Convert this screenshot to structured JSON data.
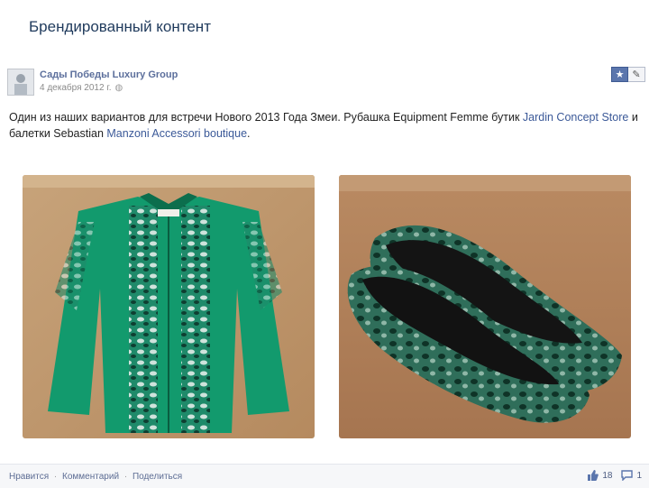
{
  "slide": {
    "title": "Брендированный контент"
  },
  "post": {
    "author": "Сады Победы Luxury Group",
    "date": "4 декабря 2012 г.",
    "text_parts": [
      "Один из наших вариантов для встречи Нового 2013 Года Змеи. Рубашка Equipment Femme бутик ",
      "Jardin Concept Store",
      " и балетки Sebastian ",
      "Manzoni Accessori boutique",
      "."
    ]
  },
  "images": {
    "shirt": "green snakeskin print shirt",
    "flats": "green leopard print ballet flats"
  },
  "footer": {
    "like": "Нравится",
    "separator": "·",
    "comment": "Комментарий",
    "share": "Поделиться",
    "likes_count": "18",
    "comments_count": "1"
  },
  "icons": {
    "globe": "globe-icon",
    "star": "star-icon",
    "edit": "pencil-icon",
    "thumb": "thumbs-up-icon",
    "comment": "comment-icon"
  },
  "colors": {
    "brand_blue": "#3b5998",
    "title": "#1f3a5c"
  }
}
